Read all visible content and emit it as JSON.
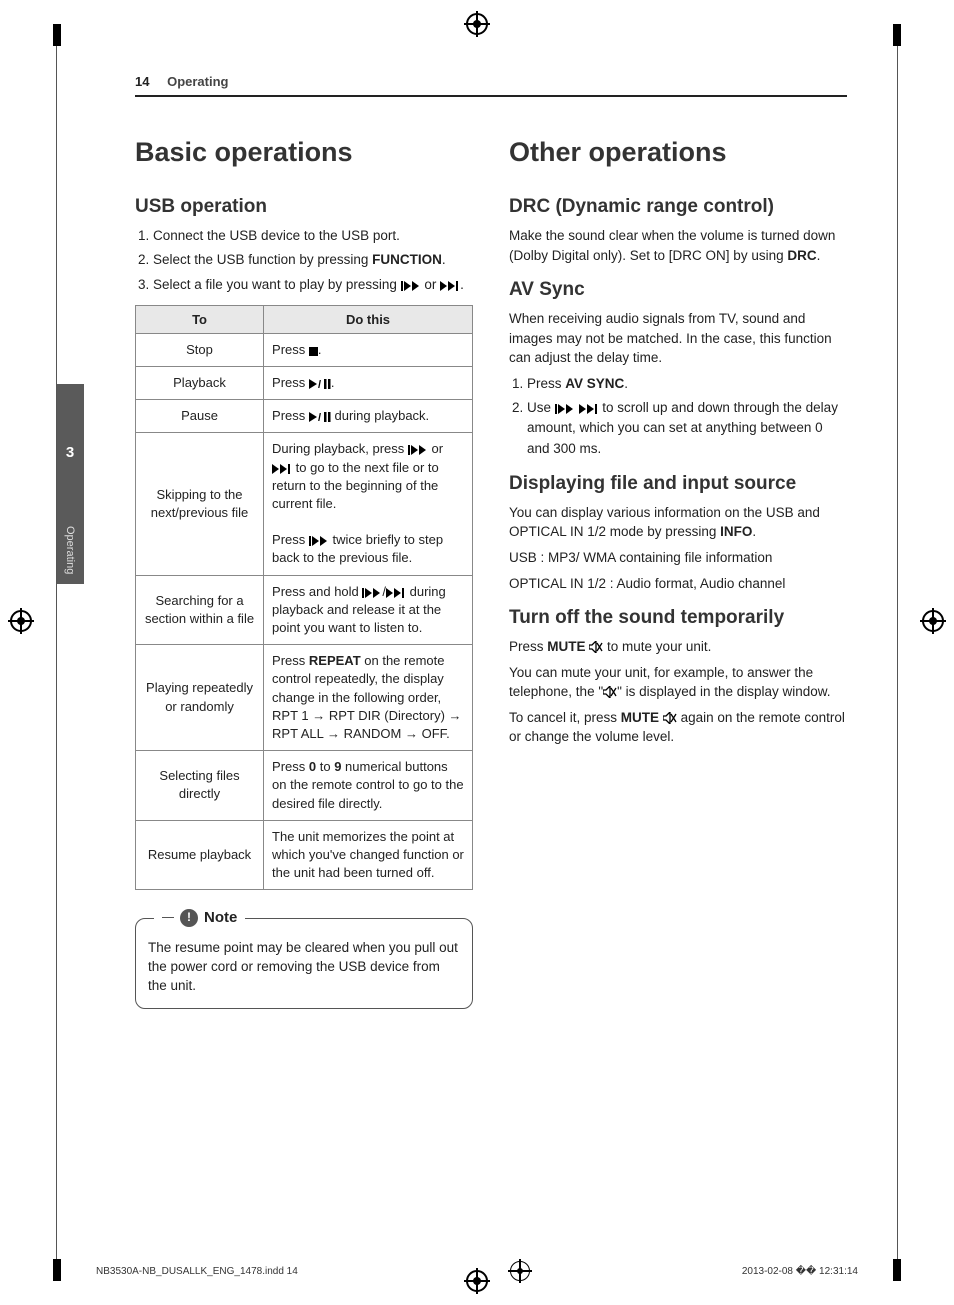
{
  "page": {
    "number": "14",
    "section": "Operating"
  },
  "sidetab": {
    "chapter": "3",
    "label": "Operating"
  },
  "left": {
    "h1": "Basic operations",
    "h2": "USB operation",
    "steps": [
      "Connect the USB device to the USB port.",
      "Select the USB function by pressing FUNCTION.",
      "Select a file you want to play by pressing [PREV] or [NEXT]."
    ],
    "table": {
      "head_to": "To",
      "head_do": "Do this",
      "rows": [
        {
          "to": "Stop",
          "do_pre": "Press ",
          "do_icon": "stop",
          "do_post": "."
        },
        {
          "to": "Playback",
          "do_pre": "Press ",
          "do_icon": "playpause",
          "do_post": "."
        },
        {
          "to": "Pause",
          "do_pre": "Press ",
          "do_icon": "playpause",
          "do_post": " during playback."
        },
        {
          "to": "Skipping to the next/previous file",
          "do": "During playback, press [PREV] or [NEXT] to go to the next file or to return to the beginning of the current file.\nPress [PREV] twice briefly to step back to the previous file."
        },
        {
          "to": "Searching for a section within a file",
          "do": "Press and hold [PREV]/[NEXT] during playback and release it at the point you want to listen to."
        },
        {
          "to": "Playing repeatedly or randomly",
          "do": "Press REPEAT on the remote control repeatedly, the display change in the following order, RPT 1 → RPT DIR (Directory) → RPT ALL → RANDOM → OFF."
        },
        {
          "to": "Selecting files directly",
          "do": "Press 0 to 9 numerical buttons on the remote control to go to the desired file directly."
        },
        {
          "to": "Resume playback",
          "do": "The unit memorizes the point at which you've changed function or the unit had been turned off."
        }
      ]
    },
    "note_label": "Note",
    "note": "The resume point may be cleared when you pull out the power cord or removing the USB device from the unit."
  },
  "right": {
    "h1": "Other operations",
    "drc_h2": "DRC (Dynamic range control)",
    "drc_body": "Make the sound clear when the volume is turned down (Dolby Digital only). Set to [DRC ON] by using DRC.",
    "av_h2": "AV Sync",
    "av_body": "When receiving audio signals from TV, sound and images may not be matched. In the case, this function can adjust the delay time.",
    "av_steps": [
      "Press AV SYNC.",
      "Use [PREV] [NEXT] to scroll up and down through the delay amount, which you can set at anything between 0 and 300 ms."
    ],
    "disp_h2": "Displaying file and input source",
    "disp_p1": "You can display various information on the USB and OPTICAL IN 1/2 mode by pressing INFO.",
    "disp_p2": "USB : MP3/ WMA containing file information",
    "disp_p3": "OPTICAL IN 1/2 : Audio format, Audio channel",
    "mute_h2": "Turn off the sound temporarily",
    "mute_p1": "Press MUTE [mute-icon] to mute your unit.",
    "mute_p2": "You can mute your unit, for example, to answer the telephone, the \"[mute-icon]\" is displayed in the display window.",
    "mute_p3": "To cancel it, press MUTE [mute-icon] again on the remote control or change the volume level."
  },
  "footer": {
    "file": "NB3530A-NB_DUSALLK_ENG_1478.indd   14",
    "datetime": "2013-02-08   �� 12:31:14"
  }
}
